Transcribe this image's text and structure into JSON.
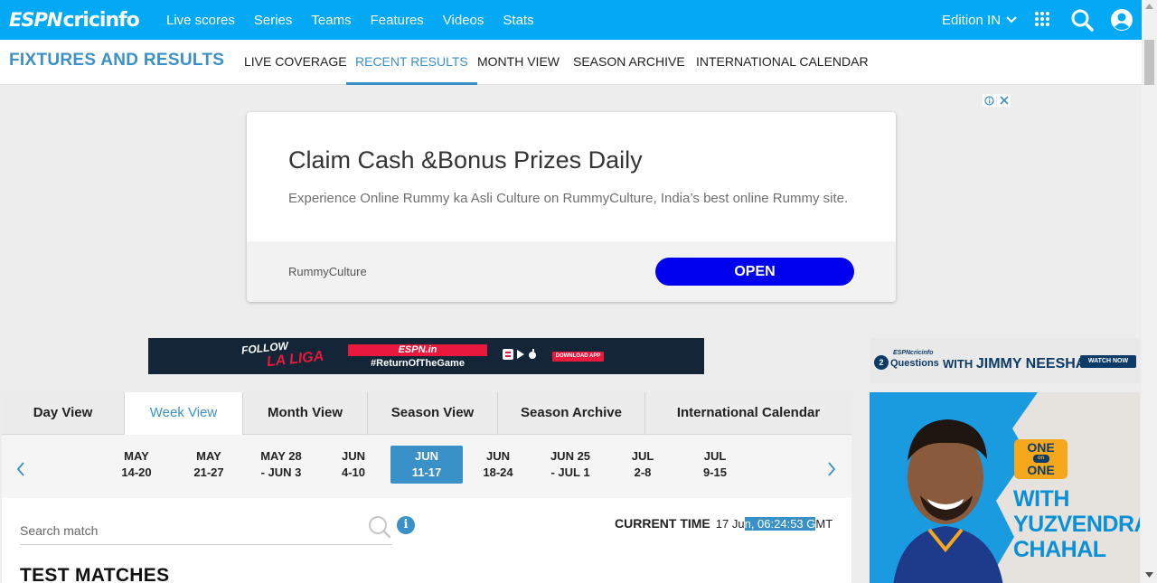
{
  "header": {
    "logo_espn": "ESPN",
    "logo_cric": "cricinfo",
    "nav": [
      "Live scores",
      "Series",
      "Teams",
      "Features",
      "Videos",
      "Stats"
    ],
    "edition": "Edition IN",
    "icons": [
      "apps-grid-icon",
      "search-icon",
      "user-icon"
    ]
  },
  "subnav": {
    "title": "FIXTURES AND RESULTS",
    "tabs": [
      "LIVE COVERAGE",
      "RECENT RESULTS",
      "MONTH VIEW",
      "SEASON ARCHIVE",
      "INTERNATIONAL CALENDAR"
    ],
    "active": "RECENT RESULTS"
  },
  "ad": {
    "headline": "Claim Cash &Bonus Prizes Daily",
    "description": "Experience Online Rummy ka Asli Culture on RummyCulture, India’s best online Rummy site.",
    "sponsor": "RummyCulture",
    "cta": "OPEN",
    "cta_color": "#0000ee"
  },
  "banner": {
    "follow": "FOLLOW",
    "laliga": "LA LIGA",
    "espn": "ESPN.in",
    "tag": "#ReturnOfTheGame",
    "download": "DOWNLOAD APP"
  },
  "view_tabs": [
    "Day View",
    "Week View",
    "Month View",
    "Season View",
    "Season Archive",
    "International Calendar"
  ],
  "active_view": "Week View",
  "weeks": [
    {
      "l1": "MAY",
      "l2": "14-20"
    },
    {
      "l1": "MAY",
      "l2": "21-27"
    },
    {
      "l1": "MAY 28",
      "l2": "- JUN 3"
    },
    {
      "l1": "JUN",
      "l2": "4-10"
    },
    {
      "l1": "JUN",
      "l2": "11-17"
    },
    {
      "l1": "JUN",
      "l2": "18-24"
    },
    {
      "l1": "JUN 25",
      "l2": "- JUL 1"
    },
    {
      "l1": "JUL",
      "l2": "2-8"
    },
    {
      "l1": "JUL",
      "l2": "9-15"
    }
  ],
  "active_week": "JUN 11-17",
  "search": {
    "placeholder": "Search match"
  },
  "current_time": {
    "label": "CURRENT TIME",
    "pre": "17 Ju",
    "selected": "n, 06:24:53 G",
    "post": "MT"
  },
  "section_title": "TEST MATCHES",
  "side_promo_1": {
    "badge": "2",
    "brand": "ESPNcricinfo",
    "label": "Questions",
    "with": "WITH",
    "name": "JIMMY NEESHAM",
    "cta": "WATCH NOW"
  },
  "side_promo_2": {
    "one1": "ONE",
    "on": "on",
    "one2": "ONE",
    "l1": "WITH",
    "l2": "YUZVENDRA",
    "l3": "CHAHAL"
  },
  "colors": {
    "brand": "#03a9f4",
    "accent": "#3a91c8",
    "promo_orange": "#f5a81c"
  }
}
